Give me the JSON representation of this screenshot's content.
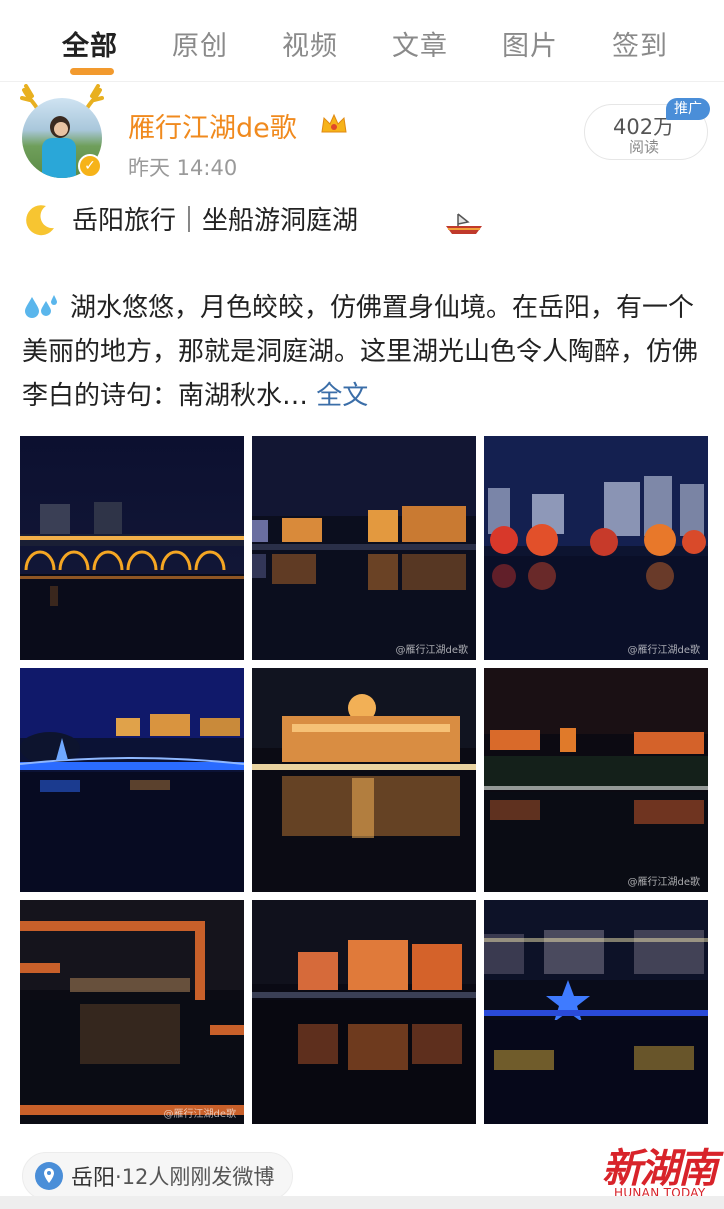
{
  "tabs": [
    {
      "label": "全部",
      "active": true
    },
    {
      "label": "原创",
      "active": false
    },
    {
      "label": "视频",
      "active": false
    },
    {
      "label": "文章",
      "active": false
    },
    {
      "label": "图片",
      "active": false
    },
    {
      "label": "签到",
      "active": false
    }
  ],
  "post": {
    "username": "雁行江湖de歌",
    "timestamp": "昨天 14:40",
    "reads": {
      "count": "402万",
      "label": "阅读",
      "promo_tag": "推广"
    },
    "title": "岳阳旅行｜坐船游洞庭湖",
    "body": "湖水悠悠，月色皎皎，仿佛置身仙境。在岳阳，有一个美丽的地方，那就是洞庭湖。这里湖光山色令人陶醉，仿佛李白的诗句：南湖秋水…",
    "full_text_link": "全文",
    "photos": [
      {
        "scene": "arched-bridge-night",
        "watermark": ""
      },
      {
        "scene": "lakeside-buildings-night",
        "watermark": "@雁行江湖de歌"
      },
      {
        "scene": "red-trees-highrises-night",
        "watermark": "@雁行江湖de歌"
      },
      {
        "scene": "blue-bridge-night",
        "watermark": ""
      },
      {
        "scene": "hall-reflection-night",
        "watermark": ""
      },
      {
        "scene": "orange-skyline-night",
        "watermark": "@雁行江湖de歌"
      },
      {
        "scene": "window-frame-view-night",
        "watermark": "@雁行江湖de歌"
      },
      {
        "scene": "apartment-reflection-night",
        "watermark": ""
      },
      {
        "scene": "blue-star-monument-night",
        "watermark": ""
      }
    ],
    "location": {
      "city": "岳阳",
      "description": "·12人刚刚发微博"
    }
  },
  "watermark_logo": {
    "cn": "新湖南",
    "en": "HUNAN TODAY"
  },
  "colors": {
    "accent": "#f29a2e",
    "username": "#f08a1e",
    "link": "#3b6ea8",
    "logo": "#d8232a"
  },
  "icons": [
    "antler-icon",
    "verified-icon",
    "crown-icon",
    "moon-icon",
    "boat-icon",
    "water-drops-icon",
    "location-pin-icon"
  ]
}
